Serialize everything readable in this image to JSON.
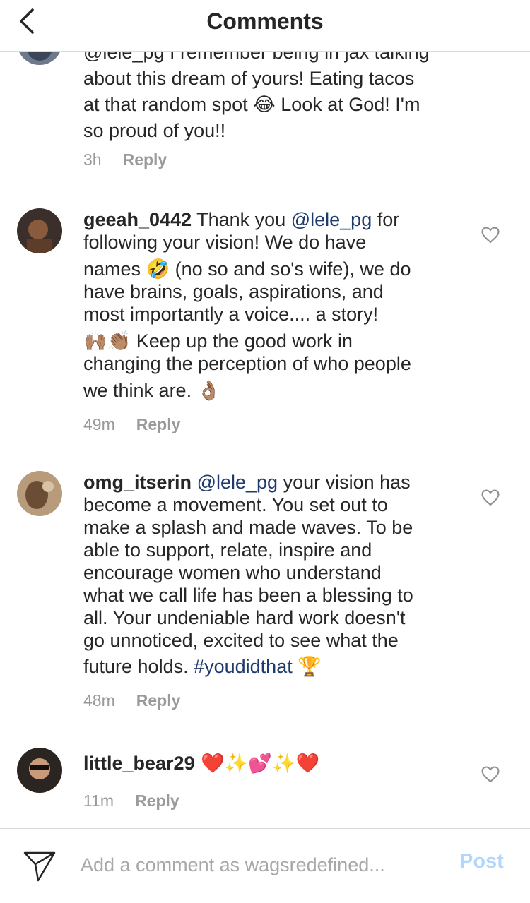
{
  "header": {
    "title": "Comments"
  },
  "comments": [
    {
      "lines": [
        "@lele_pg I remember being in jax talking",
        "about this dream of yours! Eating tacos",
        "at that random spot 😂 Look at God! I'm",
        "so proud of you!!"
      ],
      "time": "3h",
      "reply_label": "Reply"
    },
    {
      "username": "geeah_0442",
      "line1_pre": "Thank you ",
      "mention": "@lele_pg",
      "line1_post": " for",
      "lines": [
        "following your vision! We do have",
        "names 🤣 (no so and so's wife), we do",
        "have brains, goals, aspirations, and",
        "most importantly a voice.... a story!",
        "🙌🏽👏🏽  Keep up the good work in",
        "changing the perception of who people",
        "we think are. 👌🏽"
      ],
      "time": "49m",
      "reply_label": "Reply"
    },
    {
      "username": "omg_itserin",
      "mention": "@lele_pg",
      "line1_post": " your vision has",
      "lines": [
        "become a movement. You set out to",
        "make a splash and made waves. To be",
        "able to support, relate, inspire and",
        "encourage women who understand",
        "what we call life has been a blessing to",
        "all. Your undeniable hard work doesn't",
        "go unnoticed, excited to see what the"
      ],
      "last_line_pre": "future holds. ",
      "hashtag": "#youdidthat",
      "last_line_post": " 🏆",
      "time": "48m",
      "reply_label": "Reply"
    },
    {
      "username": "little_bear29",
      "text": " ❤️✨💕✨❤️",
      "time": "11m",
      "reply_label": "Reply"
    }
  ],
  "footer": {
    "placeholder": "Add a comment as wagsredefined...",
    "post_label": "Post"
  },
  "colors": {
    "mention": "#1f3b6e",
    "post_disabled": "#b3d6fb",
    "meta": "#9a9a9a"
  },
  "icons": {
    "back": "chevron-left-icon",
    "like": "heart-outline-icon",
    "send": "paper-plane-icon"
  }
}
